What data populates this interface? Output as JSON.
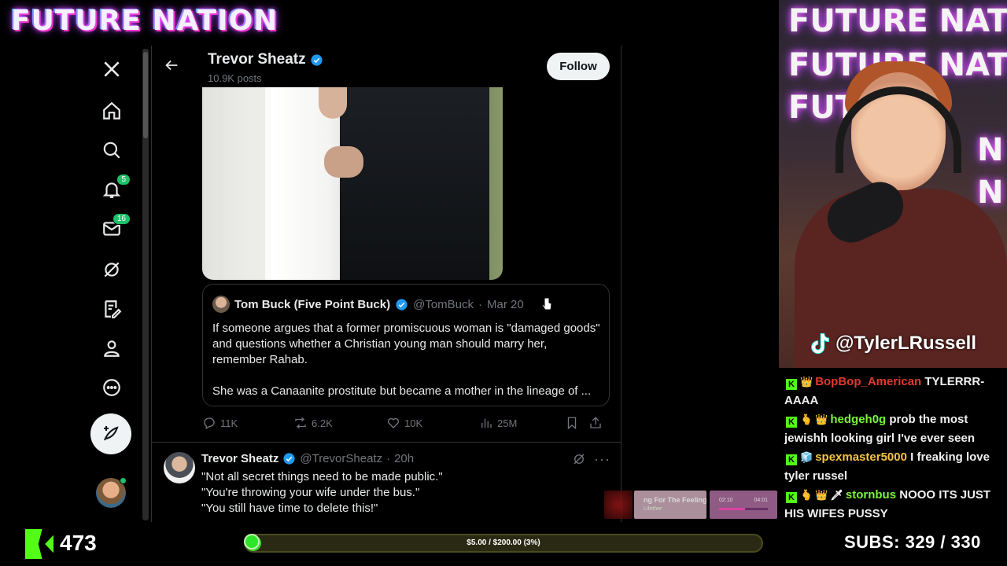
{
  "overlay": {
    "brand": "FUTURE NATION",
    "watermark_lines": [
      "FUTURE NATION",
      "FUTURE NATION",
      "FUTU",
      "N",
      "N"
    ],
    "tiktok_handle": "@TylerLRussell"
  },
  "x_nav": {
    "items": [
      {
        "name": "x-logo-icon"
      },
      {
        "name": "home-icon"
      },
      {
        "name": "search-icon"
      },
      {
        "name": "notifications-icon",
        "badge": "5"
      },
      {
        "name": "messages-icon",
        "badge": "16"
      },
      {
        "name": "grok-icon"
      },
      {
        "name": "lists-icon"
      },
      {
        "name": "profile-icon"
      },
      {
        "name": "more-icon"
      }
    ],
    "post_button_icon": "feather-plus-icon"
  },
  "profile_header": {
    "name": "Trevor Sheatz",
    "posts_count": "10.9K posts",
    "follow_label": "Follow"
  },
  "quoted_post": {
    "name": "Tom Buck (Five Point Buck)",
    "handle": "@TomBuck",
    "sep": "·",
    "date": "Mar 20",
    "text_p1": "If someone argues that a former promiscuous woman is \"damaged goods\" and questions whether a Christian young man should marry her, remember Rahab.",
    "text_p2": "She was a Canaanite prostitute but became a mother in the lineage of ..."
  },
  "post_actions": {
    "replies": "11K",
    "reposts": "6.2K",
    "likes": "10K",
    "views": "25M"
  },
  "reply_post": {
    "name": "Trevor Sheatz",
    "handle": "@TrevorSheatz",
    "sep": "·",
    "time": "20h",
    "line1": "\"Not all secret things need to be made public.\"",
    "line2": "\"You're throwing your wife under the bus.\"",
    "line3": "\"You still have time to delete this!\""
  },
  "chat": {
    "messages": [
      {
        "user": "BopBop_American",
        "text": "TYLERRR-AAAA",
        "color": "#e0392f"
      },
      {
        "user": "hedgeh0g",
        "text": "prob the most jewishh looking girl I've ever seen",
        "color": "#7cf53c"
      },
      {
        "user": "spexmaster5000",
        "text": "I freaking love tyler russel",
        "color": "#f5c542"
      },
      {
        "user": "stornbus",
        "text": "NOOO ITS JUST HIS WIFES PUSSY",
        "color": "#7cf53c"
      }
    ]
  },
  "bottom_bar": {
    "viewers": "473",
    "goal_text": "$5.00 / $200.00 (3%)",
    "goal_progress": 0.03,
    "subs_label": "SUBS:",
    "subs_value": "329 / 330"
  },
  "now_playing": {
    "title": "ng For The Feeling",
    "artist": "Lifether",
    "time_elapsed": "02:10",
    "time_total": "04:01",
    "progress": 0.54
  },
  "colors": {
    "x_blue": "#1d9bf0",
    "kick_green": "#53fc18",
    "timeline_border": "#2f3336",
    "muted_text": "#71767b"
  }
}
